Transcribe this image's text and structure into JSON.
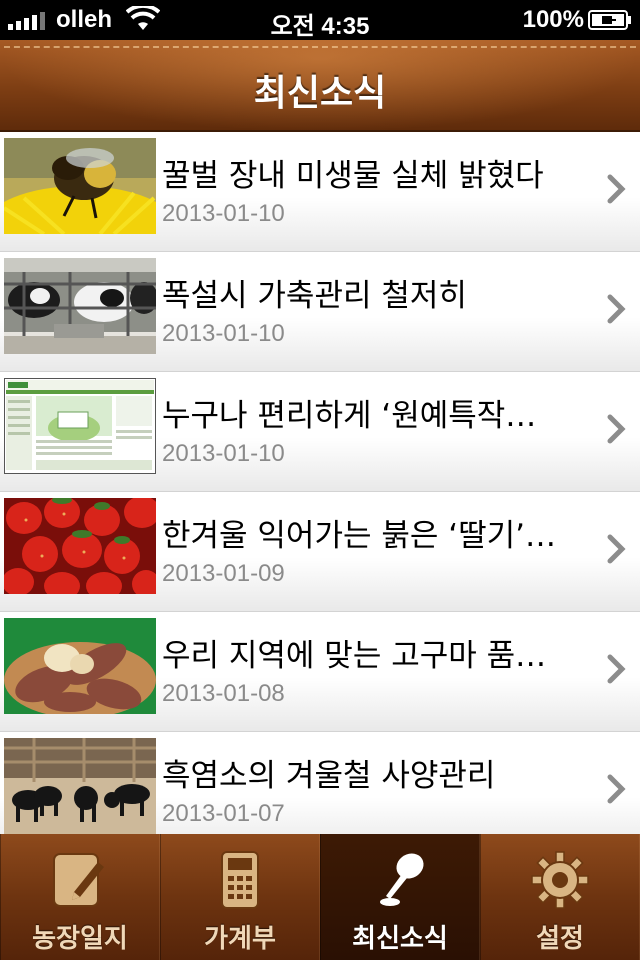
{
  "status_bar": {
    "carrier": "olleh",
    "time": "오전 4:35",
    "battery": "100%"
  },
  "header": {
    "title": "최신소식"
  },
  "news": [
    {
      "title": "꿀벌 장내 미생물 실체 밝혔다",
      "date": "2013-01-10",
      "thumb": "bee-on-flower"
    },
    {
      "title": "폭설시 가축관리 철저히",
      "date": "2013-01-10",
      "thumb": "cows-in-barn"
    },
    {
      "title": "누구나 편리하게 ‘원예특작…",
      "date": "2013-01-10",
      "thumb": "website-screenshot"
    },
    {
      "title": "한겨울 익어가는 붉은 ‘딸기’…",
      "date": "2013-01-09",
      "thumb": "strawberries"
    },
    {
      "title": "우리 지역에 맞는 고구마 품…",
      "date": "2013-01-08",
      "thumb": "sweet-potatoes"
    },
    {
      "title": "흑염소의 겨울철 사양관리",
      "date": "2013-01-07",
      "thumb": "black-goats"
    }
  ],
  "tabs": [
    {
      "label": "농장일지",
      "icon": "pencil-note-icon",
      "active": false
    },
    {
      "label": "가계부",
      "icon": "calculator-icon",
      "active": false
    },
    {
      "label": "최신소식",
      "icon": "microphone-icon",
      "active": true
    },
    {
      "label": "설정",
      "icon": "gear-icon",
      "active": false
    }
  ],
  "colors": {
    "leather": "#7c3d13",
    "active_tab": "#2a1003",
    "date_text": "#8a8a8a"
  }
}
